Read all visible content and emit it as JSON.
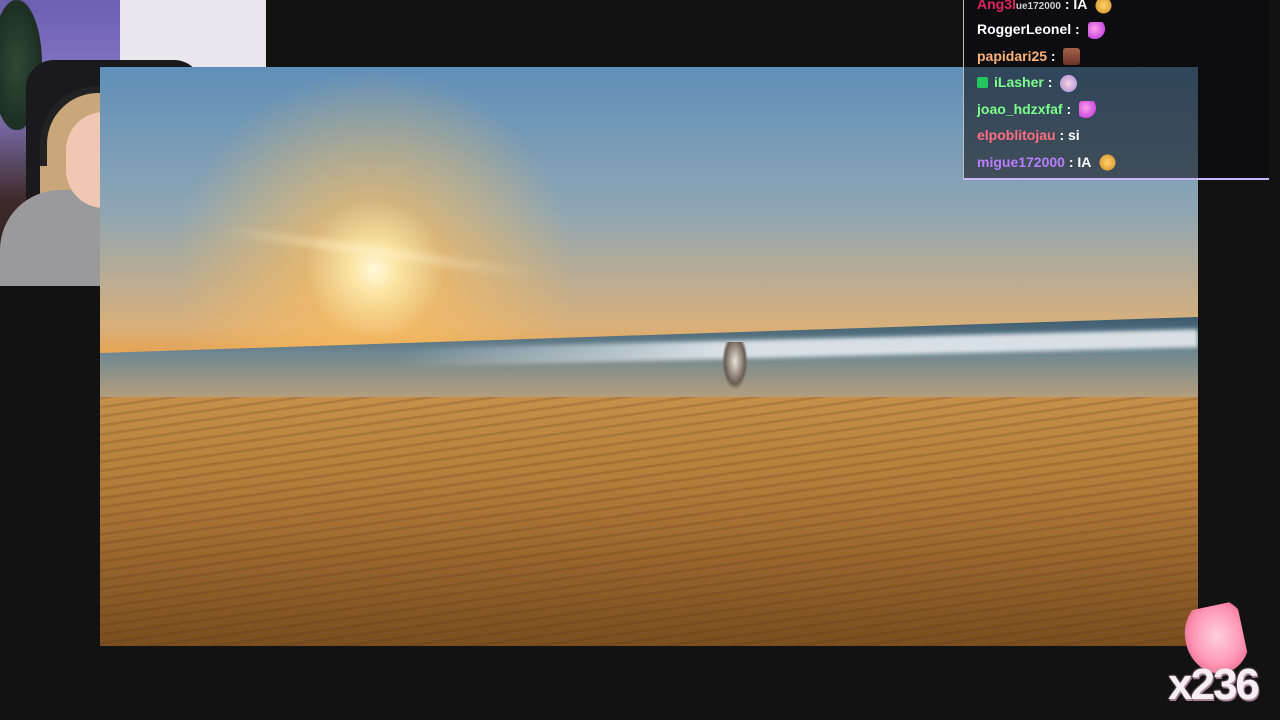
{
  "video": {
    "description_hidden": ""
  },
  "chat": {
    "messages": [
      {
        "user": "Ang3l",
        "prefix": "ue172000",
        "text": "IA",
        "user_color": "#e0245e",
        "emote": "face"
      },
      {
        "user": "RoggerLeonel",
        "text": "",
        "user_color": "#ffffff",
        "emote": "pink"
      },
      {
        "user": "papidari25",
        "text": "",
        "user_color": "#ffb27a",
        "emote": "brown"
      },
      {
        "user": "iLasher",
        "text": "",
        "user_color": "#7dff8b",
        "emote": "sticker",
        "badge": true
      },
      {
        "user": "joao_hdzxfaf",
        "text": "",
        "user_color": "#7dff8b",
        "emote": "pink"
      },
      {
        "user": "elpoblitojau",
        "text": "si",
        "user_color": "#ff6e7f",
        "emote": ""
      },
      {
        "user": "migue172000",
        "text": "IA",
        "user_color": "#b77dff",
        "emote": "face"
      }
    ],
    "separator": ":"
  },
  "reaction": {
    "count_label": "x236",
    "icon": "praying-hands-icon"
  },
  "colors": {
    "background": "#121212",
    "chat_border": "#c9b6ff"
  }
}
